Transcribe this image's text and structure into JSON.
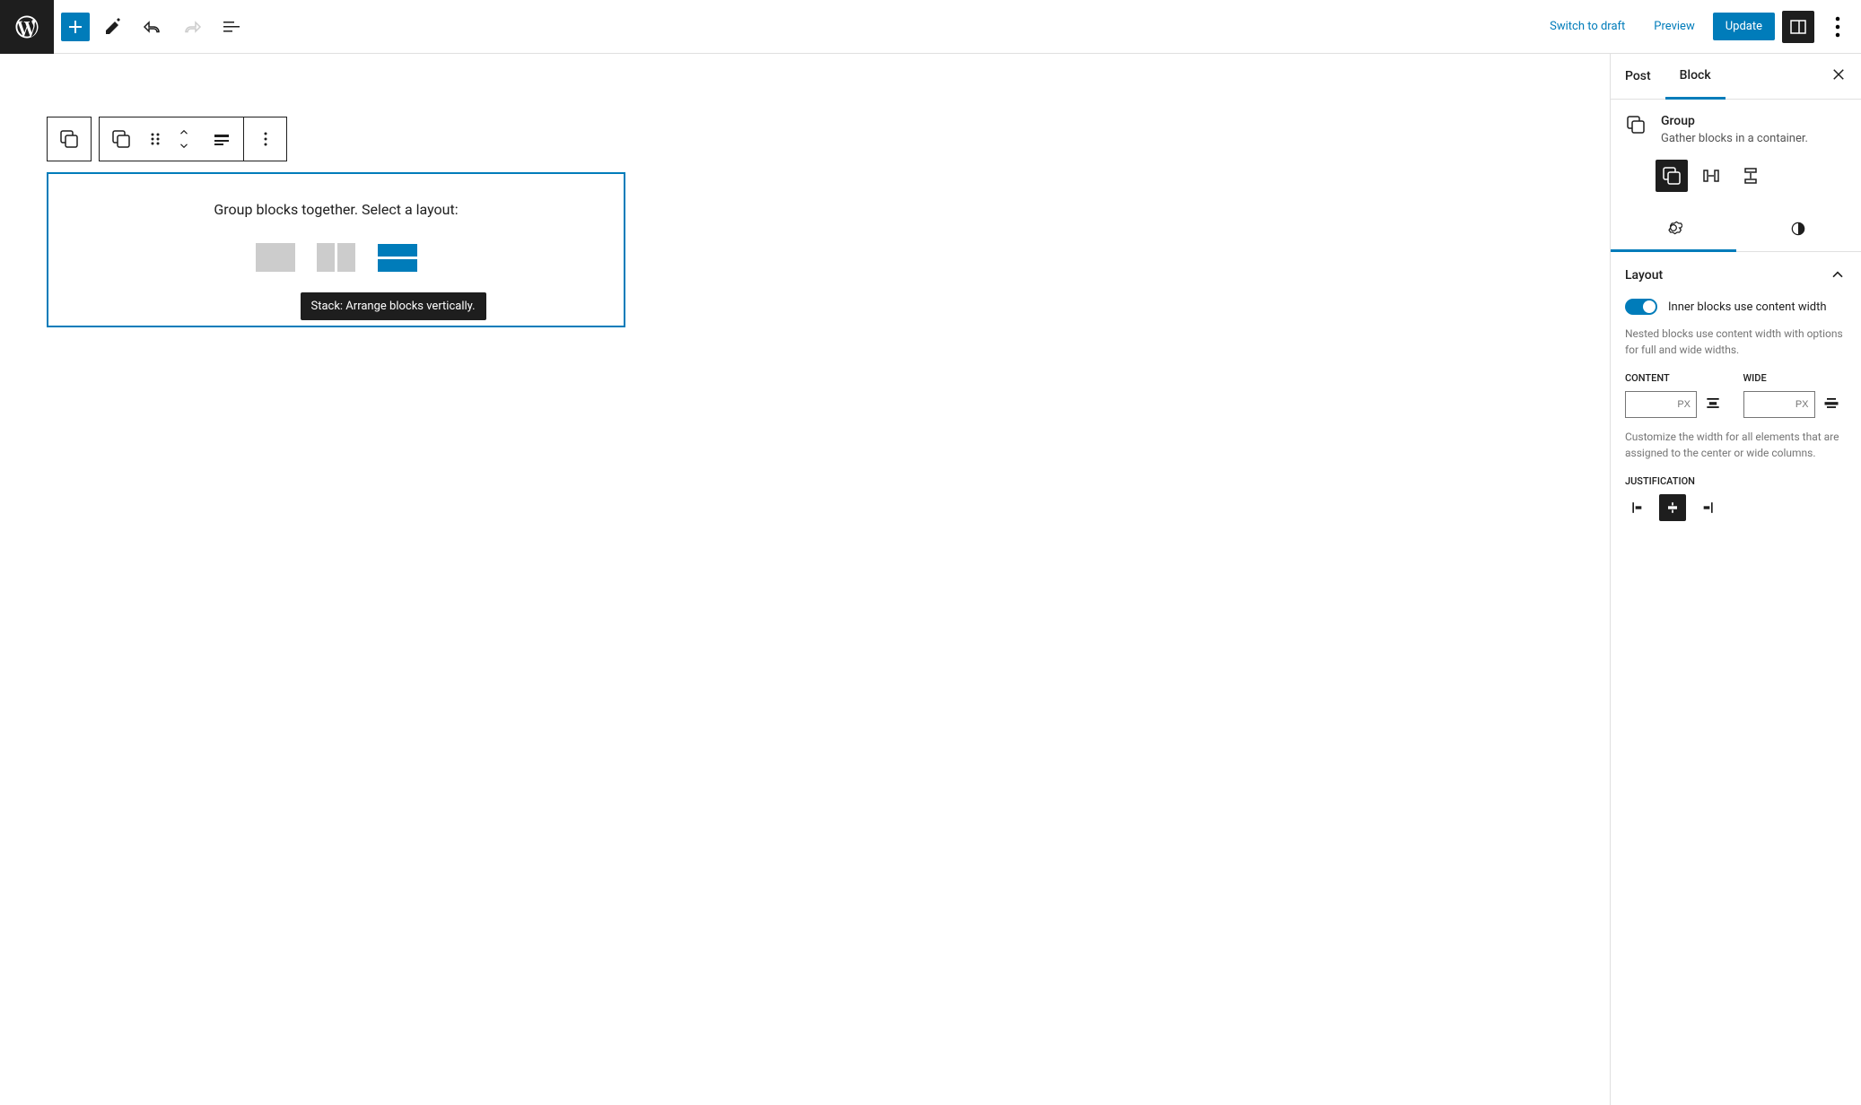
{
  "topbar": {
    "switch_to_draft": "Switch to draft",
    "preview": "Preview",
    "update": "Update"
  },
  "canvas": {
    "placeholder_text": "Group blocks together. Select a layout:",
    "tooltip": "Stack: Arrange blocks vertically."
  },
  "sidebar": {
    "tabs": {
      "post": "Post",
      "block": "Block"
    },
    "block_info": {
      "title": "Group",
      "description": "Gather blocks in a container."
    },
    "layout": {
      "title": "Layout",
      "toggle_label": "Inner blocks use content width",
      "help_text": "Nested blocks use content width with options for full and wide widths.",
      "content_label": "CONTENT",
      "wide_label": "WIDE",
      "unit": "PX",
      "width_help": "Customize the width for all elements that are assigned to the center or wide columns.",
      "justification_label": "JUSTIFICATION"
    }
  }
}
